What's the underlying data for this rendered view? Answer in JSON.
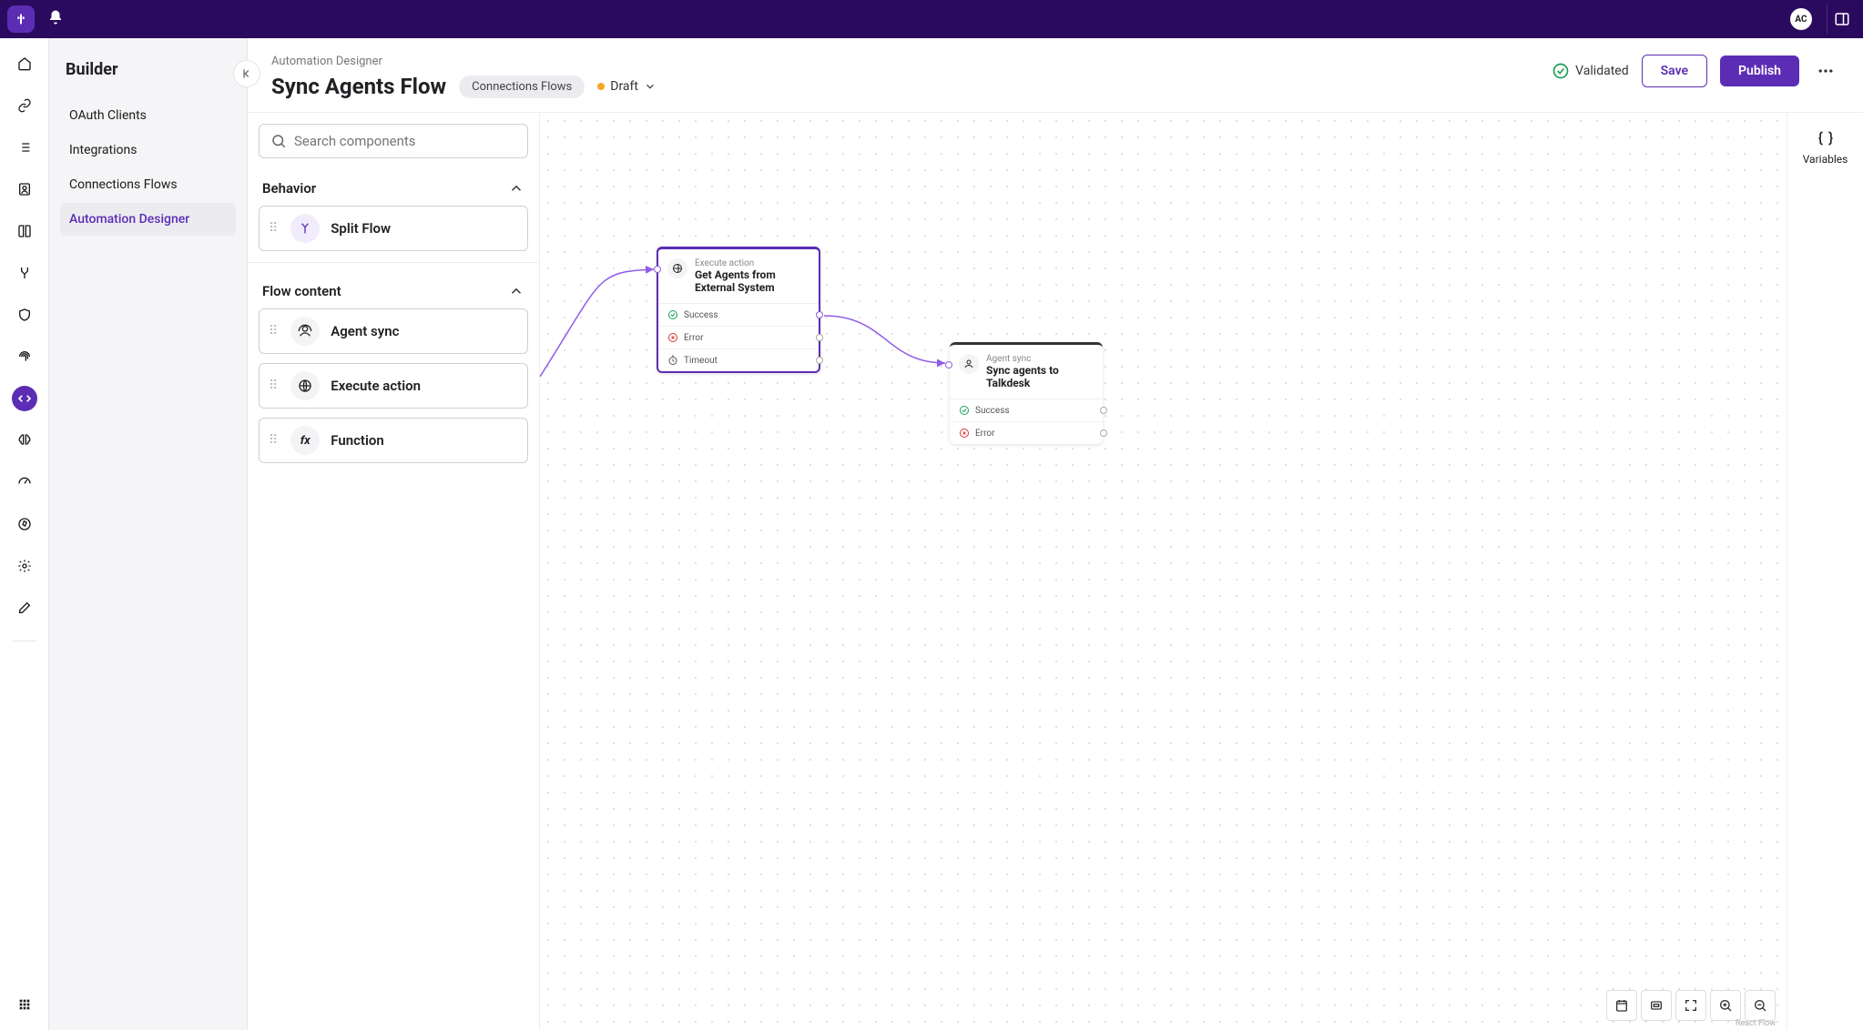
{
  "avatar": "AC",
  "sidebar": {
    "title": "Builder",
    "items": [
      "OAuth Clients",
      "Integrations",
      "Connections Flows",
      "Automation Designer"
    ],
    "active_index": 3
  },
  "header": {
    "breadcrumb": "Automation Designer",
    "title": "Sync Agents Flow",
    "tag": "Connections Flows",
    "status": "Draft",
    "validated": "Validated",
    "save": "Save",
    "publish": "Publish"
  },
  "palette": {
    "search_placeholder": "Search components",
    "section_behavior": "Behavior",
    "behavior_items": [
      {
        "label": "Split Flow",
        "icon": "split"
      }
    ],
    "section_flow": "Flow content",
    "flow_items": [
      {
        "label": "Agent sync",
        "icon": "agent"
      },
      {
        "label": "Execute action",
        "icon": "globe"
      },
      {
        "label": "Function",
        "icon": "fx"
      }
    ]
  },
  "nodes": {
    "n1": {
      "type": "Execute action",
      "title": "Get Agents from External System",
      "rows": [
        "Success",
        "Error",
        "Timeout"
      ]
    },
    "n2": {
      "type": "Agent sync",
      "title": "Sync agents to Talkdesk",
      "rows": [
        "Success",
        "Error"
      ]
    }
  },
  "vars_label": "Variables",
  "react_flow": "React Flow"
}
